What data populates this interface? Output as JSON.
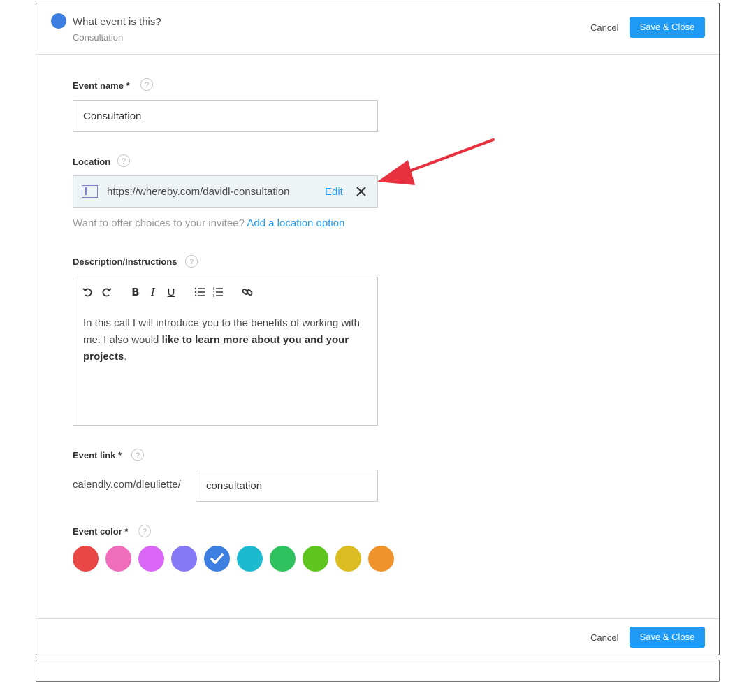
{
  "header": {
    "title": "What event is this?",
    "subtitle": "Consultation",
    "dot_color": "#3d7fe0",
    "cancel_label": "Cancel",
    "save_label": "Save & Close"
  },
  "event_name": {
    "label": "Event name *",
    "help": "?",
    "value": "Consultation"
  },
  "location": {
    "label": "Location",
    "help": "?",
    "url": "https://whereby.com/davidl-consultation",
    "edit_label": "Edit",
    "icon": "video-window-icon",
    "hint_text": "Want to offer choices to your invitee?",
    "hint_link": "Add a location option"
  },
  "description": {
    "label": "Description/Instructions",
    "help": "?",
    "toolbar": [
      "undo-icon",
      "redo-icon",
      "bold-icon",
      "italic-icon",
      "underline-icon",
      "bulleted-list-icon",
      "numbered-list-icon",
      "link-icon"
    ],
    "text_normal_1": "In this call I will introduce you to the benefits of working with me. I also would ",
    "text_bold": "like to learn more about you and your projects",
    "text_normal_2": "."
  },
  "event_link": {
    "label": "Event link *",
    "help": "?",
    "prefix": "calendly.com/dleuliette/",
    "value": "consultation"
  },
  "event_color": {
    "label": "Event color *",
    "help": "?",
    "colors": [
      "#ea4747",
      "#f06dbb",
      "#da67f5",
      "#8778f5",
      "#3d7fe0",
      "#1cb9cf",
      "#2fc25f",
      "#5ec51e",
      "#dbbc21",
      "#f0932c"
    ],
    "selected_index": 4
  },
  "footer": {
    "cancel_label": "Cancel",
    "save_label": "Save & Close"
  },
  "annotation_arrow_color": "#e8313f"
}
